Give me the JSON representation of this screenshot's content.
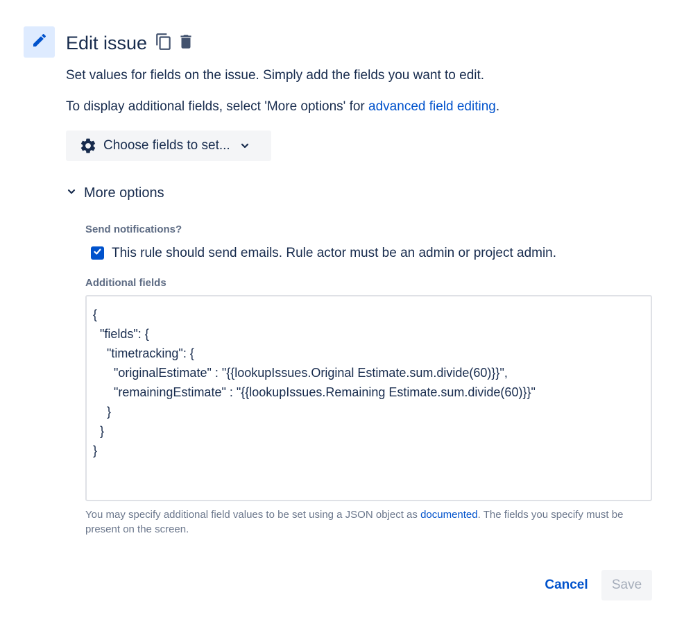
{
  "header": {
    "title": "Edit issue",
    "edit_icon": "pencil-icon",
    "copy_icon": "copy-icon",
    "delete_icon": "trash-icon"
  },
  "description": {
    "line1": "Set values for fields on the issue. Simply add the fields you want to edit.",
    "line2_prefix": "To display additional fields, select 'More options' for ",
    "line2_link": "advanced field editing",
    "line2_suffix": "."
  },
  "choose_fields": {
    "label": "Choose fields to set...",
    "icon": "gear-icon",
    "chevron": "chevron-down-icon"
  },
  "more_options": {
    "label": "More options",
    "expanded": true
  },
  "notifications": {
    "label": "Send notifications?",
    "checkbox_label": "This rule should send emails. Rule actor must be an admin or project admin.",
    "checked": true
  },
  "additional_fields": {
    "label": "Additional fields",
    "lines": [
      "{",
      "  \"fields\": {",
      "    \"timetracking\": {",
      "      \"originalEstimate\" : \"{{lookupIssues.Original Estimate.sum.divide(60)}}\",",
      "      \"remainingEstimate\" : \"{{lookupIssues.Remaining Estimate.sum.divide(60)}}\"",
      "    }",
      "  }",
      "}"
    ]
  },
  "help": {
    "prefix": "You may specify additional field values to be set using a JSON object as ",
    "link": "documented",
    "suffix": ". The fields you specify must be present on the screen."
  },
  "footer": {
    "cancel_label": "Cancel",
    "save_label": "Save"
  },
  "colors": {
    "primary": "#0052cc",
    "text": "#172b4d",
    "subtle": "#5e6c84",
    "tile_bg": "#deebff",
    "button_bg": "#f4f5f7",
    "border": "#dfe1e6"
  }
}
